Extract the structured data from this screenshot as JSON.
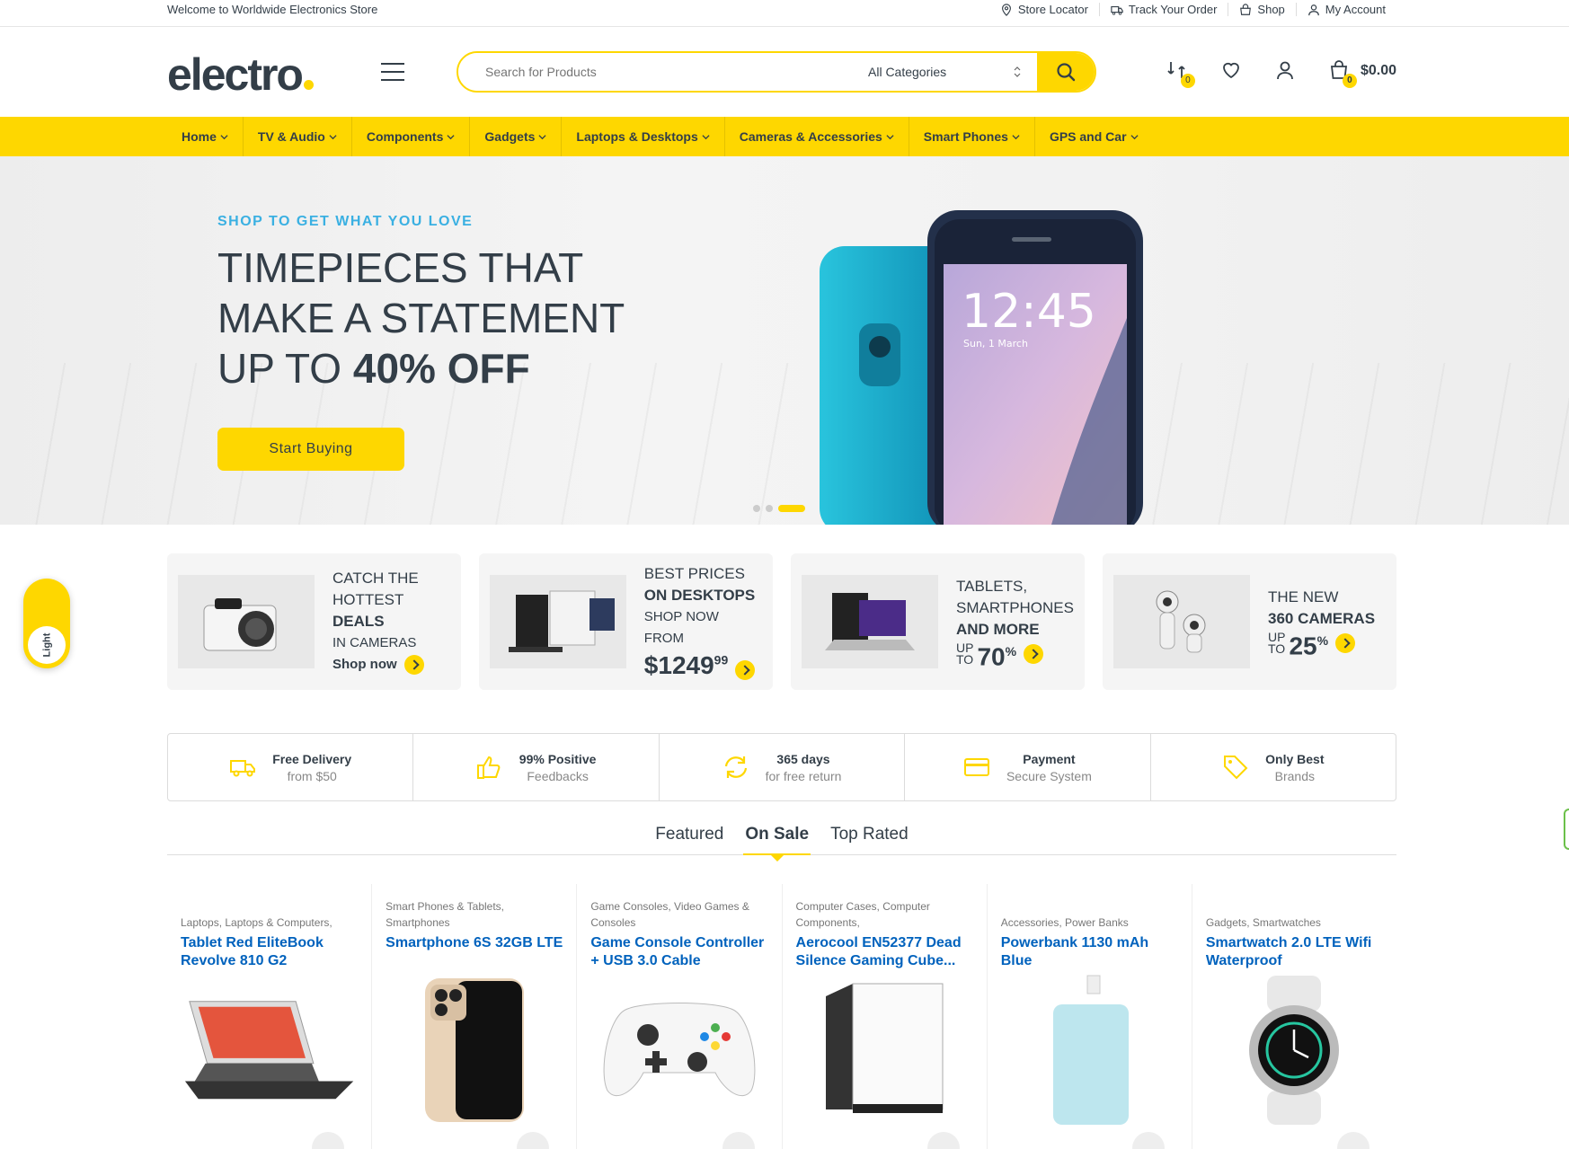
{
  "topbar": {
    "welcome": "Welcome to Worldwide Electronics Store",
    "links": [
      {
        "label": "Store Locator",
        "icon": "map-pin-icon"
      },
      {
        "label": "Track Your Order",
        "icon": "truck-icon"
      },
      {
        "label": "Shop",
        "icon": "bag-icon"
      },
      {
        "label": "My Account",
        "icon": "user-icon"
      }
    ]
  },
  "header": {
    "logo": "electro",
    "search": {
      "placeholder": "Search for Products",
      "category": "All Categories"
    },
    "compare_count": "0",
    "cart_count": "0",
    "cart_total": "$0.00"
  },
  "nav": {
    "items": [
      "Home",
      "TV & Audio",
      "Components",
      "Gadgets",
      "Laptops & Desktops",
      "Cameras & Accessories",
      "Smart Phones",
      "GPS and Car"
    ]
  },
  "hero": {
    "pretitle": "SHOP TO GET WHAT YOU LOVE",
    "line1": "TIMEPIECES THAT",
    "line2": "MAKE A STATEMENT",
    "line3_prefix": "UP TO ",
    "line3_bold": "40% OFF",
    "cta": "Start Buying",
    "phone_time": "12:45",
    "phone_date": "Sun, 1 March"
  },
  "promos": [
    {
      "l1": "CATCH THE",
      "l2": "HOTTEST",
      "l3": "DEALS",
      "l4": "IN CAMERAS",
      "link": "Shop now"
    },
    {
      "l1": "BEST PRICES",
      "l2": "ON DESKTOPS",
      "l3": "SHOP NOW FROM",
      "price_dollars": "$1249",
      "price_cents": "99"
    },
    {
      "l1": "TABLETS,",
      "l2": "SMARTPHONES",
      "l3": "AND MORE",
      "up": "UP",
      "to": "TO",
      "pct": "70",
      "pct_sign": "%"
    },
    {
      "l1": "THE NEW",
      "l2": "360 CAMERAS",
      "up": "UP",
      "to": "TO",
      "pct": "25",
      "pct_sign": "%"
    }
  ],
  "features": [
    {
      "t1": "Free Delivery",
      "t2": "from $50",
      "icon": "truck-icon"
    },
    {
      "t1": "99% Positive",
      "t2": "Feedbacks",
      "icon": "thumbs-up-icon"
    },
    {
      "t1": "365 days",
      "t2": "for free return",
      "icon": "refresh-icon"
    },
    {
      "t1": "Payment",
      "t2": "Secure System",
      "icon": "credit-card-icon"
    },
    {
      "t1": "Only Best",
      "t2": "Brands",
      "icon": "tag-icon"
    }
  ],
  "tabs": [
    "Featured",
    "On Sale",
    "Top Rated"
  ],
  "products": [
    {
      "cat": "Laptops, Laptops & Computers,",
      "name": "Tablet Red EliteBook Revolve 810 G2"
    },
    {
      "cat": "Smart Phones & Tablets, Smartphones",
      "name": "Smartphone 6S 32GB LTE"
    },
    {
      "cat": "Game Consoles, Video Games & Consoles",
      "name": "Game Console Controller + USB 3.0 Cable"
    },
    {
      "cat": "Computer Cases, Computer Components,",
      "name": "Aerocool EN52377 Dead Silence Gaming Cube..."
    },
    {
      "cat": "Accessories, Power Banks",
      "name": "Powerbank 1130 mAh Blue"
    },
    {
      "cat": "Gadgets, Smartwatches",
      "name": "Smartwatch 2.0 LTE Wifi Waterproof"
    }
  ],
  "toggle": {
    "label": "Light"
  },
  "colors": {
    "accent": "#fed700",
    "text": "#333e48",
    "link": "#0062bd",
    "pretitle": "#3ab0e2"
  }
}
